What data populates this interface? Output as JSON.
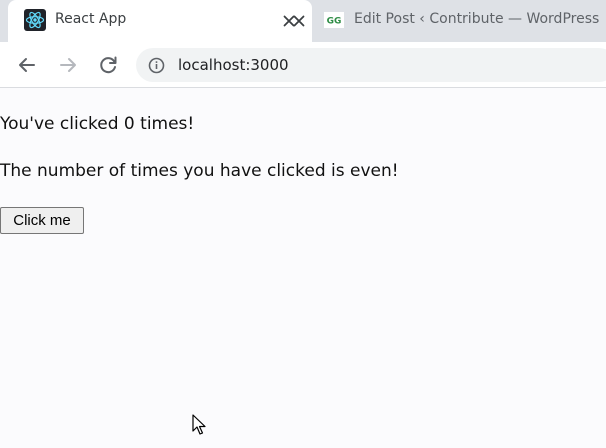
{
  "browser": {
    "tabs": [
      {
        "title": "React App",
        "favicon": "react-logo-icon",
        "active": true
      },
      {
        "title": "Edit Post ‹ Contribute — WordPress",
        "favicon": "gfg-logo-icon",
        "favicon_text": "GG",
        "active": false
      }
    ],
    "address_bar": {
      "url": "localhost:3000"
    }
  },
  "page": {
    "click_message": "You've clicked 0 times!",
    "parity_message": "The number of times you have clicked is even!",
    "button_label": "Click me"
  },
  "colors": {
    "react": "#61dafb",
    "gfg": "#2f8d46",
    "tabstrip": "#dee1e6"
  }
}
